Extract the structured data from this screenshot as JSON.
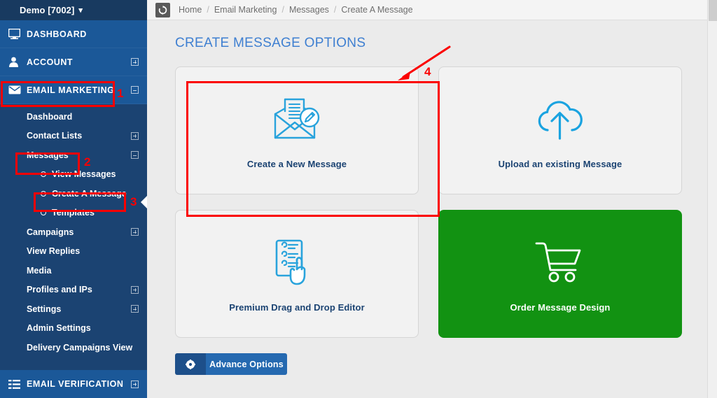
{
  "sidebar": {
    "brand": {
      "label": "Demo [7002]",
      "caret_icon": "chevron-down-icon"
    },
    "top_items": [
      {
        "label": "DASHBOARD",
        "icon": "monitor-icon",
        "expander": null
      },
      {
        "label": "ACCOUNT",
        "icon": "user-icon",
        "expander": "plus"
      },
      {
        "label": "EMAIL MARKETING",
        "icon": "envelope-icon",
        "expander": "minus"
      }
    ],
    "sub_items": [
      {
        "label": "Dashboard",
        "expander": null
      },
      {
        "label": "Contact Lists",
        "expander": "plus"
      },
      {
        "label": "Messages",
        "expander": "minus"
      },
      {
        "label": "Campaigns",
        "expander": "plus"
      },
      {
        "label": "View Replies",
        "expander": null
      },
      {
        "label": "Media",
        "expander": null
      },
      {
        "label": "Profiles and IPs",
        "expander": "plus"
      },
      {
        "label": "Settings",
        "expander": "plus"
      },
      {
        "label": "Admin Settings",
        "expander": null
      },
      {
        "label": "Delivery Campaigns View",
        "expander": null
      }
    ],
    "messages_children": [
      {
        "label": "View Messages"
      },
      {
        "label": "Create A Message"
      },
      {
        "label": "Templates"
      }
    ],
    "bottom_item": {
      "label": "EMAIL VERIFICATION",
      "icon": "list-icon",
      "expander": "plus"
    }
  },
  "breadcrumb": {
    "refresh_icon": "refresh-icon",
    "items": [
      "Home",
      "Email Marketing",
      "Messages",
      "Create A Message"
    ],
    "separator": "/"
  },
  "main": {
    "page_title": "CREATE MESSAGE OPTIONS",
    "cards": [
      {
        "label": "Create a New Message",
        "icon": "envelope-document-edit-icon",
        "style": "light"
      },
      {
        "label": "Upload an existing Message",
        "icon": "cloud-upload-icon",
        "style": "light"
      },
      {
        "label": "Premium Drag and Drop Editor",
        "icon": "checklist-hand-icon",
        "style": "light"
      },
      {
        "label": "Order Message Design",
        "icon": "shopping-cart-icon",
        "style": "green"
      }
    ],
    "advance_button": {
      "label": "Advance Options",
      "icon": "gear-icon"
    }
  },
  "annotations": {
    "markers": [
      "1",
      "2",
      "3",
      "4"
    ]
  },
  "colors": {
    "sidebar_dark": "#1b4372",
    "sidebar_top": "#1b5898",
    "brand_bar": "#183a60",
    "accent_blue": "#3e7fd1",
    "card_icon_blue": "#29a3dc",
    "green_card": "#129212",
    "annotation_red": "#fb0000",
    "button_blue": "#2569b0"
  }
}
